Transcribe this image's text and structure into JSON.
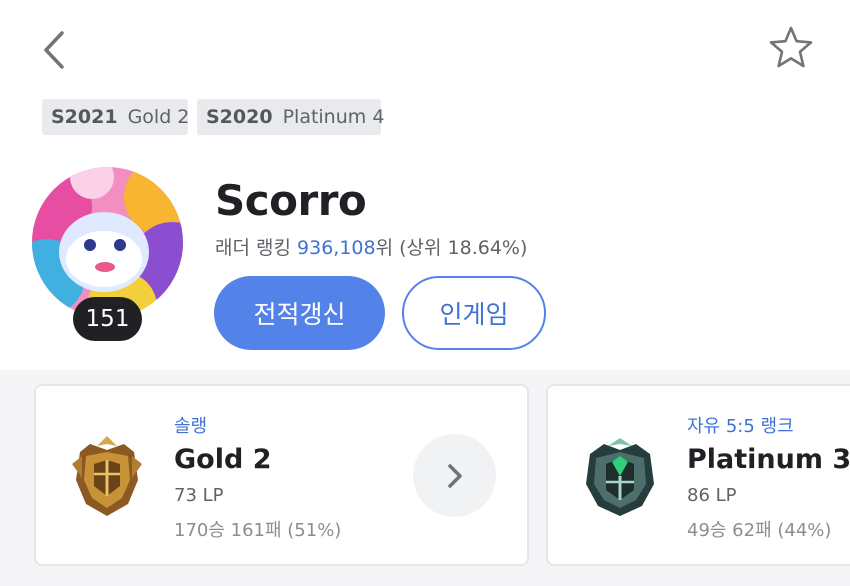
{
  "header": {
    "back_icon": "chevron-left-icon",
    "favorite_icon": "star-outline-icon"
  },
  "seasons": [
    {
      "year": "S2021",
      "tier": "Gold 2"
    },
    {
      "year": "S2020",
      "tier": "Platinum 4"
    }
  ],
  "profile": {
    "level": "151",
    "name": "Scorro",
    "ladder_label": "래더 랭킹",
    "ladder_rank": "936,108",
    "ladder_suffix": "위",
    "ladder_top": "(상위 18.64%)"
  },
  "actions": {
    "renew_label": "전적갱신",
    "ingame_label": "인게임"
  },
  "ranks": [
    {
      "queue": "솔랭",
      "tier": "Gold 2",
      "lp": "73 LP",
      "record": "170승 161패 (51%)",
      "emblem": "gold-emblem-icon"
    },
    {
      "queue": "자유 5:5 랭크",
      "tier": "Platinum 3",
      "lp": "86 LP",
      "record": "49승 62패 (44%)",
      "emblem": "platinum-emblem-icon"
    }
  ],
  "colors": {
    "accent": "#5383e8",
    "link": "#4171d6",
    "background": "#f5f5f7"
  }
}
